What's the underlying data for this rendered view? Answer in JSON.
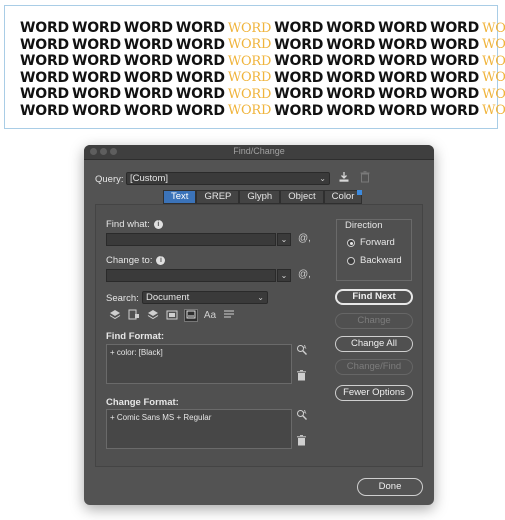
{
  "document": {
    "rows": [
      [
        "WORD",
        "WORD",
        "WORD",
        "WORD",
        "WORD",
        "WORD",
        "WORD",
        "WORD",
        "WORD",
        "WORD"
      ],
      [
        "WORD",
        "WORD",
        "WORD",
        "WORD",
        "WORD",
        "WORD",
        "WORD",
        "WORD",
        "WORD",
        "WORD"
      ],
      [
        "WORD",
        "WORD",
        "WORD",
        "WORD",
        "WORD",
        "WORD",
        "WORD",
        "WORD",
        "WORD",
        "WORD"
      ],
      [
        "WORD",
        "WORD",
        "WORD",
        "WORD",
        "WORD",
        "WORD",
        "WORD",
        "WORD",
        "WORD",
        "WORD"
      ],
      [
        "WORD",
        "WORD",
        "WORD",
        "WORD",
        "WORD",
        "WORD",
        "WORD",
        "WORD",
        "WORD",
        "WORD"
      ],
      [
        "WORD",
        "WORD",
        "WORD",
        "WORD",
        "WORD",
        "WORD",
        "WORD",
        "WORD",
        "WORD",
        "WORD"
      ]
    ],
    "highlight_color": "#f0b43c"
  },
  "dialog": {
    "title": "Find/Change",
    "query_label": "Query:",
    "query_value": "[Custom]",
    "tabs": [
      {
        "label": "Text",
        "active": true
      },
      {
        "label": "GREP",
        "active": false
      },
      {
        "label": "Glyph",
        "active": false
      },
      {
        "label": "Object",
        "active": false
      },
      {
        "label": "Color",
        "active": false
      }
    ],
    "find_what_label": "Find what:",
    "find_what_value": "",
    "change_to_label": "Change to:",
    "change_to_value": "",
    "search_label": "Search:",
    "search_value": "Document",
    "direction": {
      "label": "Direction",
      "forward": "Forward",
      "backward": "Backward",
      "selected": "Forward"
    },
    "find_format_label": "Find Format:",
    "find_format_value": "+ color: [Black]",
    "change_format_label": "Change Format:",
    "change_format_value": "+ Comic Sans MS + Regular",
    "buttons": {
      "find_next": "Find Next",
      "change": "Change",
      "change_all": "Change All",
      "change_find": "Change/Find",
      "fewer_options": "Fewer Options",
      "done": "Done"
    },
    "colors": {
      "dialog_bg": "#535353",
      "active_tab": "#3b73b9"
    }
  }
}
